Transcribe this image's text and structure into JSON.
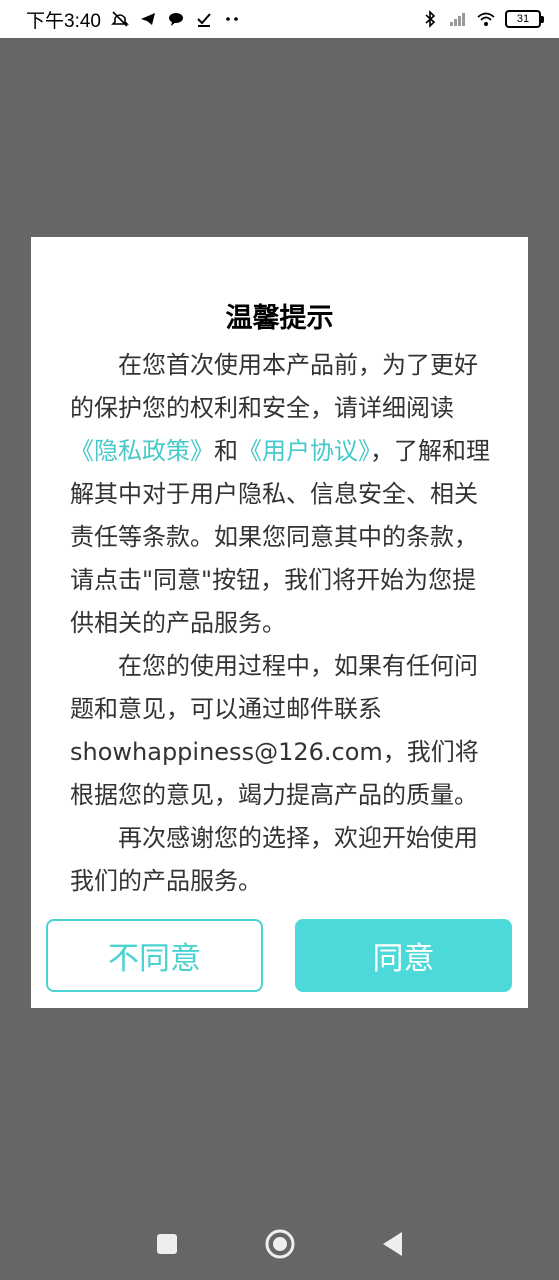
{
  "status_bar": {
    "time": "下午3:40",
    "battery": "31",
    "icons": [
      "mute-icon",
      "telegram-icon",
      "chat-icon",
      "check-icon",
      "more-dots-icon",
      "bluetooth-icon",
      "signal-icon",
      "wifi-icon",
      "battery-icon"
    ]
  },
  "dialog": {
    "title": "温馨提示",
    "p1_text_a": "在您首次使用本产品前，为了更好的保护您的权利和安全，请详细阅读",
    "privacy_link": "《隐私政策》",
    "and": "和",
    "agreement_link": "《用户协议》",
    "p1_text_b": "，了解和理解其中对于用户隐私、信息安全、相关责任等条款。如果您同意其中的条款，请点击\"同意\"按钮，我们将开始为您提供相关的产品服务。",
    "p2": "在您的使用过程中，如果有任何问题和意见，可以通过邮件联系showhappiness@126.com，我们将根据您的意见，竭力提高产品的质量。",
    "p3": "再次感谢您的选择，欢迎开始使用我们的产品服务。",
    "disagree_label": "不同意",
    "agree_label": "同意"
  },
  "colors": {
    "accent": "#4dd9d9",
    "link": "#48c9c9",
    "backdrop": "#666666"
  },
  "nav": {
    "icons": [
      "recents-square-icon",
      "home-circle-icon",
      "back-triangle-icon"
    ]
  }
}
